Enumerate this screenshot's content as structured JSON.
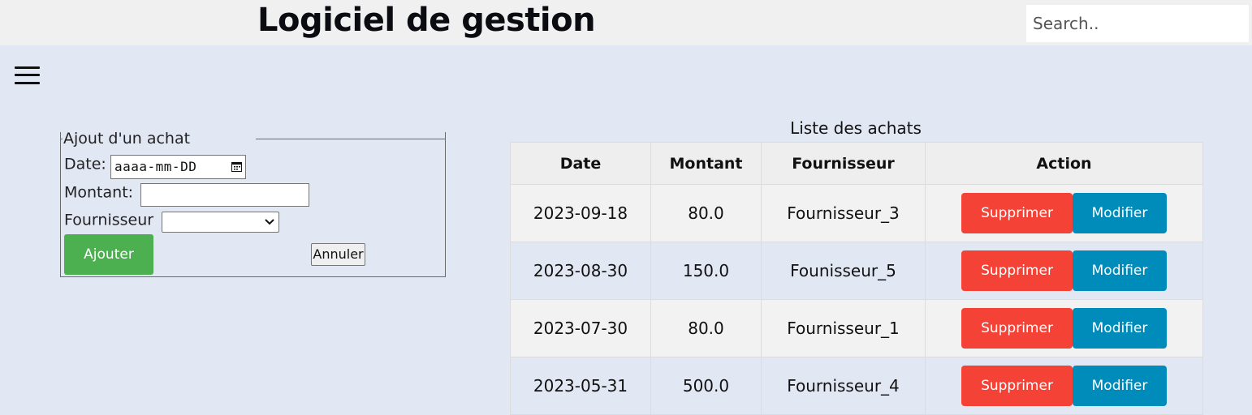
{
  "header": {
    "title": "Logiciel de gestion",
    "search_placeholder": "Search.."
  },
  "form": {
    "legend": "Ajout d'un achat",
    "date_label": "Date:",
    "date_placeholder": "aaaa-mm-DD",
    "montant_label": "Montant:",
    "montant_value": "",
    "fournisseur_label": "Fournisseur",
    "fournisseur_selected": "",
    "submit_label": "Ajouter",
    "cancel_label": "Annuler"
  },
  "list": {
    "caption": "Liste des achats",
    "columns": [
      "Date",
      "Montant",
      "Fournisseur",
      "Action"
    ],
    "rows": [
      {
        "date": "2023-09-18",
        "montant": "80.0",
        "fournisseur": "Fournisseur_3"
      },
      {
        "date": "2023-08-30",
        "montant": "150.0",
        "fournisseur": "Founisseur_5"
      },
      {
        "date": "2023-07-30",
        "montant": "80.0",
        "fournisseur": "Fournisseur_1"
      },
      {
        "date": "2023-05-31",
        "montant": "500.0",
        "fournisseur": "Fournisseur_4"
      }
    ],
    "delete_label": "Supprimer",
    "edit_label": "Modifier"
  },
  "colors": {
    "background": "#e2e7f4",
    "submit": "#4caf50",
    "delete": "#f44336",
    "edit": "#008cba"
  }
}
